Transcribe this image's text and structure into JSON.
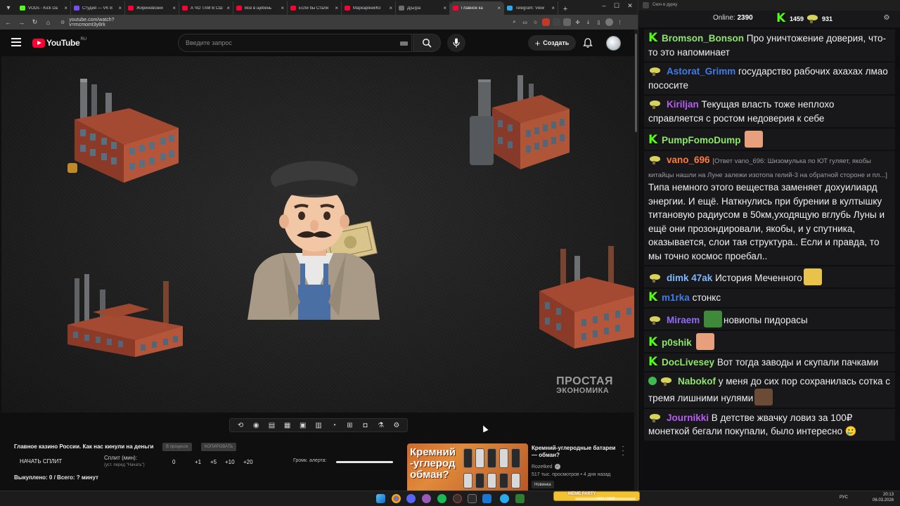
{
  "browser": {
    "tabs": [
      {
        "title": "VODs - Kick Da",
        "color": "#53fc18",
        "active": false
      },
      {
        "title": "Студия — VK В",
        "color": "#7a4cff",
        "active": false
      },
      {
        "title": "Жириновский",
        "color": "#ff0033",
        "active": false
      },
      {
        "title": "А ЧО ТАМ В СШ",
        "color": "#ff0033",
        "active": false
      },
      {
        "title": "Все в щебень",
        "color": "#ff0033",
        "active": false
      },
      {
        "title": "Если бы Стали",
        "color": "#ff0033",
        "active": false
      },
      {
        "title": "Маркаряни/Ко",
        "color": "#ff0033",
        "active": false
      },
      {
        "title": "Д(ы)ра",
        "color": "#6e6e6e",
        "active": false
      },
      {
        "title": "Главное ка",
        "color": "#ff0033",
        "active": true
      },
      {
        "title": "Telegram: View",
        "color": "#2aabee",
        "active": false
      }
    ],
    "url": "youtube.com/watch?v=mcmomt3y8rk"
  },
  "youtube": {
    "logo_text": "YouTube",
    "country": "RU",
    "search_placeholder": "Введите запрос",
    "create_label": "Создать",
    "video": {
      "watermark_line1": "ПРОСТАЯ",
      "watermark_line2": "ЭКОНОМИКА"
    },
    "title": "Главное казино России. Как нас кинули на деньги",
    "chip_in_progress": "В процессе",
    "chip_copy": "КОПИРОВАТЬ",
    "split": {
      "start_label": "НАЧАТЬ СПЛИТ",
      "label": "Сплит (мин):",
      "hint": "(уст. перед \"Начать\")",
      "value": "0",
      "steps": [
        "+1",
        "+5",
        "+10",
        "+20"
      ]
    },
    "alert_volume_label": "Громк. алерта:",
    "alert_volume_level": 1.0,
    "paid_summary": "Выкуплено: 0 / Всего: ? минут",
    "recommendation": {
      "thumb_text": "Кремний\n-углерод\nобман?",
      "title": "Кремний-углеродные батареи — обман?",
      "channel": "Rozetked",
      "meta": "517 тыс. просмотров • 4 дня назад",
      "badge": "Новинка"
    }
  },
  "chat": {
    "window_title": "Скоч в дурку",
    "online_label": "Online:",
    "online_count": "2390",
    "kick_count": "1459",
    "twitch_count": "931",
    "messages": [
      {
        "badge": "kick",
        "user": "Bromson_Bonson",
        "color": "#8ee66a",
        "text": "Про уничтожение доверия, что-то это напоминает"
      },
      {
        "badge": "troll",
        "user": "Astorat_Grimm",
        "color": "#3d7de8",
        "text": "государство рабочих ахахах лмао пососите"
      },
      {
        "badge": "troll",
        "user": "Kiriljan",
        "color": "#b65cf0",
        "text": "Текущая власть тоже неплохо справляется с ростом недоверия к себе"
      },
      {
        "badge": "kick",
        "user": "PumpFomoDump",
        "color": "#8ee66a",
        "text": "",
        "emote": "#e8a07c"
      },
      {
        "badge": "troll",
        "user": "vano_696",
        "color": "#ff7a3d",
        "reply": "[Ответ vano_696: Шизомулька по ЮТ гуляет, якобы китайцы нашли на Луне залежи изотопа гелий-3 на обратной стороне и пл...]",
        "text": "Типа немного этого вещества заменяет дохуилиард энергии. И ещё. Наткнулись при бурении в култышку титановую радиусом в 50км,уходящую вглубь Луны и ещё они прозондировали, якобы, и у спутника, оказывается, слои тая структура.. Если и правда, то мы точно космос проебал.."
      },
      {
        "badge": "troll",
        "user": "dimk 47ak",
        "color": "#7fb8ff",
        "text": "История Меченного",
        "emote_after": "#e8c24a"
      },
      {
        "badge": "kick",
        "user": "m1rka",
        "color": "#3d7de8",
        "text": "стонкс"
      },
      {
        "badge": "troll",
        "user": "Miraem",
        "color": "#8e6cf5",
        "text": "новиопы пидорасы",
        "emote_before": "#3f8a3a"
      },
      {
        "badge": "kick",
        "user": "p0shik",
        "color": "#8ee66a",
        "text": "",
        "emote": "#e8a07c"
      },
      {
        "badge": "kick",
        "user": "DocLivesey",
        "color": "#8ee66a",
        "text": "Вот тогда заводы и скупали пачками"
      },
      {
        "badge": "troll",
        "user": "Nabokof",
        "color": "#8ee66a",
        "text": "у меня до сих пор сохранилась сотка с тремя лишними нулями",
        "emote_after": "#6b4a36",
        "ok": true
      },
      {
        "badge": "troll",
        "user": "Journikki",
        "color": "#b65cf0",
        "text": "В детстве жвачку ловиз за 100₽ монеткой бегали покупали, было интересно",
        "emoji": "🥲"
      }
    ]
  },
  "taskbar": {
    "widget_title": "MEME PARTY",
    "widget_progress": "1431 / 1500",
    "lang": "РУС",
    "time": "20:13",
    "date": "06.03.2026"
  }
}
